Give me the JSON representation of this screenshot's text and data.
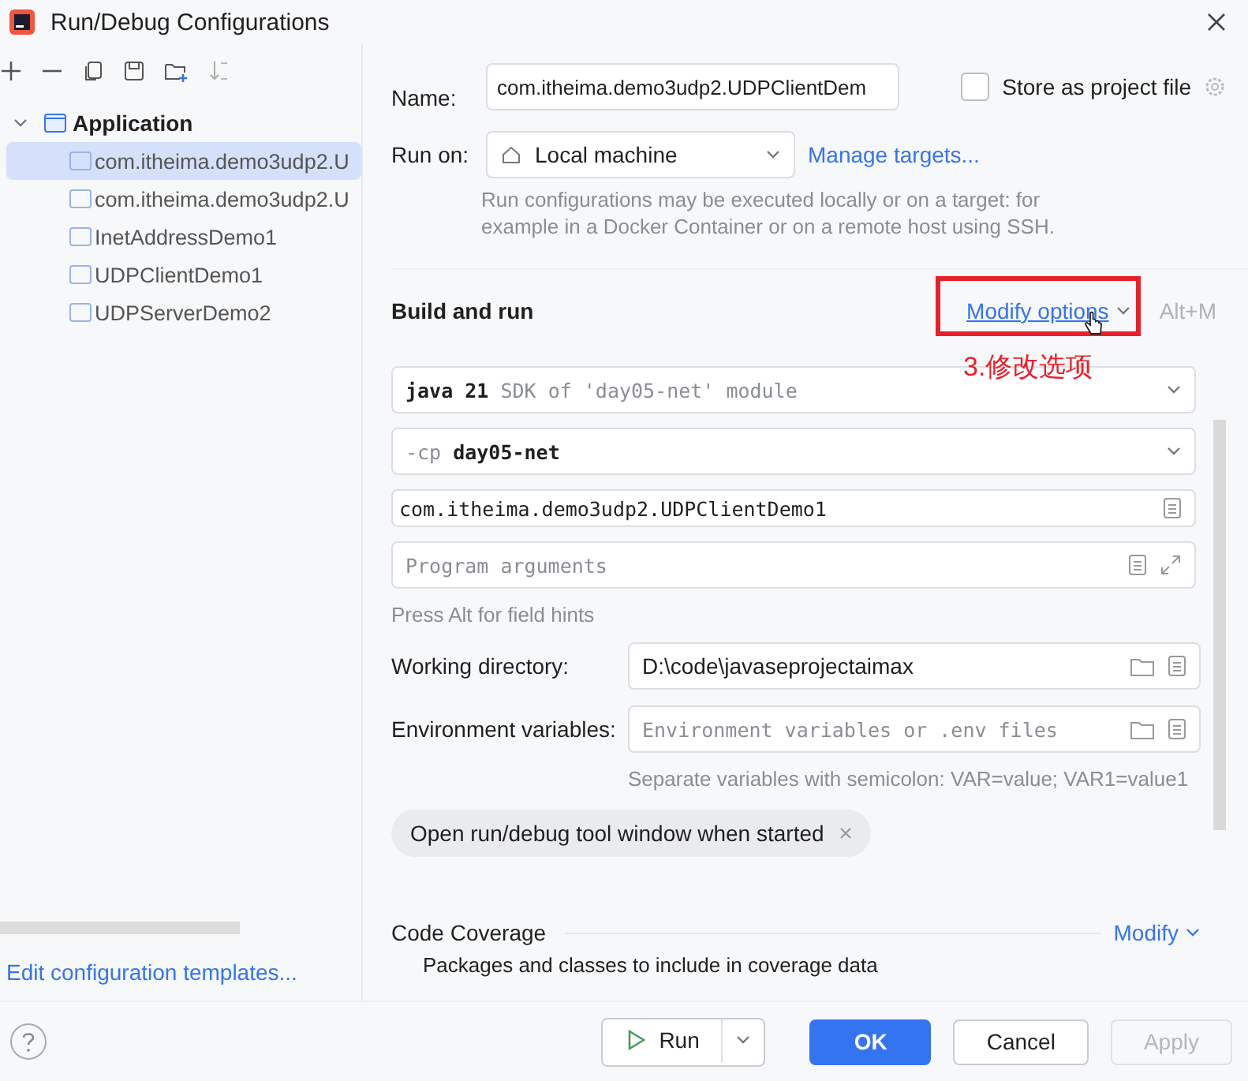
{
  "window": {
    "title": "Run/Debug Configurations"
  },
  "tree": {
    "label": "Application",
    "expanded": true,
    "children": [
      {
        "label": "com.itheima.demo3udp2.U",
        "selected": true
      },
      {
        "label": "com.itheima.demo3udp2.U",
        "selected": false
      },
      {
        "label": "InetAddressDemo1",
        "selected": false
      },
      {
        "label": "UDPClientDemo1",
        "selected": false
      },
      {
        "label": "UDPServerDemo2",
        "selected": false
      }
    ]
  },
  "edit_templates_link": "Edit configuration templates...",
  "name": {
    "label": "Name:",
    "value": "com.itheima.demo3udp2.UDPClientDem"
  },
  "store_as_project_file": {
    "label": "Store as project file",
    "checked": false
  },
  "run_on": {
    "label": "Run on:",
    "value": "Local machine",
    "link": "Manage targets...",
    "hint": "Run configurations may be executed locally or on a target: for example in a Docker Container or on a remote host using SSH."
  },
  "build_and_run": {
    "title": "Build and run",
    "modify_options": "Modify options",
    "shortcut": "Alt+M",
    "annotation": "3.修改选项",
    "jre": {
      "value": "java 21",
      "detail": "SDK of 'day05-net' module"
    },
    "classpath": {
      "prefix": "-cp",
      "value": "day05-net"
    },
    "main_class": "com.itheima.demo3udp2.UDPClientDemo1",
    "program_arguments": {
      "placeholder": "Program arguments"
    },
    "field_hint": "Press Alt for field hints"
  },
  "working_directory": {
    "label": "Working directory:",
    "value": "D:\\code\\javaseprojectaimax"
  },
  "environment_variables": {
    "label": "Environment variables:",
    "placeholder": "Environment variables or .env files",
    "hint": "Separate variables with semicolon: VAR=value; VAR1=value1"
  },
  "option_chip": "Open run/debug tool window when started",
  "code_coverage": {
    "title": "Code Coverage",
    "modify": "Modify",
    "text": "Packages and classes to include in coverage data"
  },
  "buttons": [
    {
      "label": "Run",
      "kind": "run",
      "disabled": false
    },
    {
      "label": "OK",
      "kind": "primary",
      "disabled": false
    },
    {
      "label": "Cancel",
      "kind": "normal",
      "disabled": false
    },
    {
      "label": "Apply",
      "kind": "normal",
      "disabled": true
    }
  ]
}
